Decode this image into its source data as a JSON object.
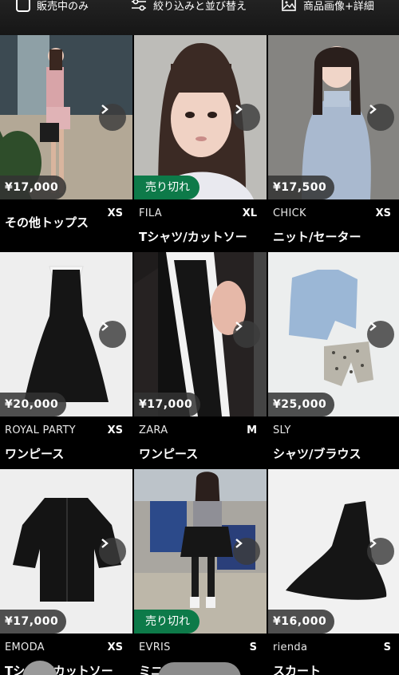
{
  "topbar": {
    "onsale_label": "販売中のみ",
    "filter_label": "絞り込みと並び替え",
    "view_label": "商品画像+詳細"
  },
  "items": [
    {
      "price": "¥17,000",
      "brand": "",
      "size": "XS",
      "category": "その他トップス",
      "sold_out": false
    },
    {
      "price": "",
      "brand": "FILA",
      "size": "XL",
      "category": "Tシャツ/カットソー",
      "sold_out": true,
      "sold_label": "売り切れ"
    },
    {
      "price": "¥17,500",
      "brand": "CHICK",
      "size": "XS",
      "category": "ニット/セーター",
      "sold_out": false
    },
    {
      "price": "¥20,000",
      "brand": "ROYAL PARTY",
      "size": "XS",
      "category": "ワンピース",
      "sold_out": false
    },
    {
      "price": "¥17,000",
      "brand": "ZARA",
      "size": "M",
      "category": "ワンピース",
      "sold_out": false
    },
    {
      "price": "¥25,000",
      "brand": "SLY",
      "size": "",
      "category": "シャツ/ブラウス",
      "sold_out": false
    },
    {
      "price": "¥17,000",
      "brand": "EMODA",
      "size": "XS",
      "category": "Tシャツ/カットソー",
      "sold_out": false
    },
    {
      "price": "",
      "brand": "EVRIS",
      "size": "S",
      "category": "ミニスカート",
      "sold_out": true,
      "sold_label": "売り切れ"
    },
    {
      "price": "¥16,000",
      "brand": "rienda",
      "size": "S",
      "category": "スカート",
      "sold_out": false
    }
  ],
  "colors": {
    "sold_out_badge": "#0d7a49",
    "price_badge": "#323232"
  },
  "icons": {
    "onsale": "checkbox-icon",
    "filter": "sliders-icon",
    "view": "image-icon",
    "next": "chevron-right-icon"
  }
}
